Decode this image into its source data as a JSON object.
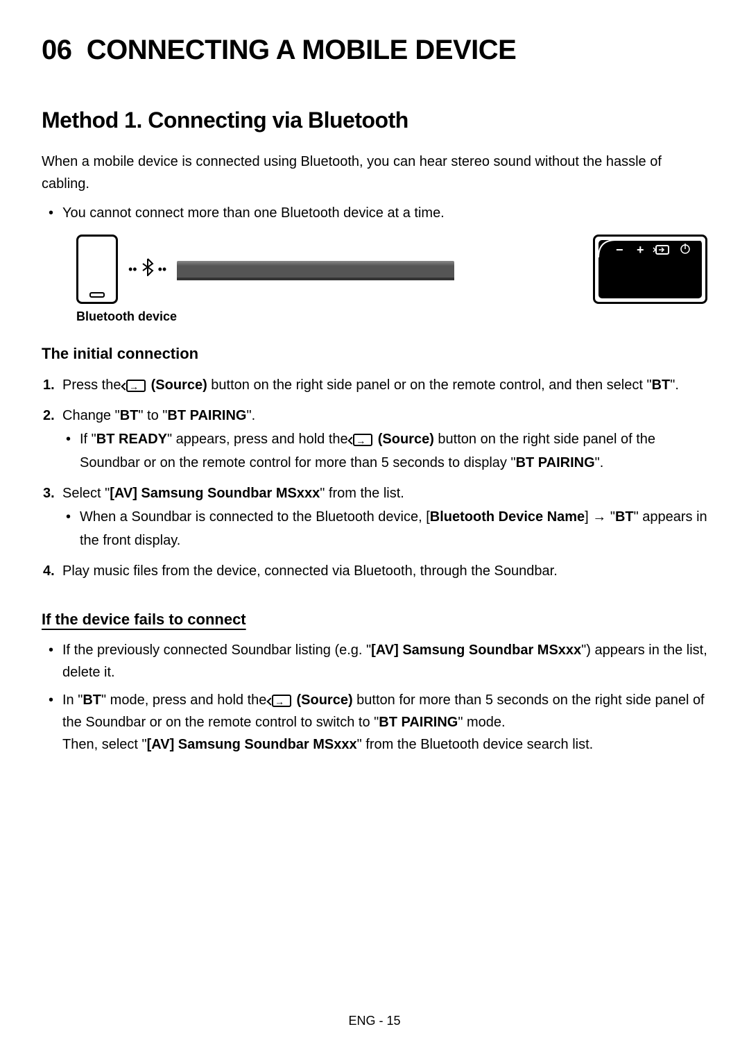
{
  "chapter": {
    "number": "06",
    "title": "CONNECTING A MOBILE DEVICE"
  },
  "method": {
    "title": "Method 1. Connecting via Bluetooth",
    "intro": "When a mobile device is connected using Bluetooth, you can hear stereo sound without the hassle of cabling.",
    "note": "You cannot connect more than one Bluetooth device at a time."
  },
  "diagram": {
    "label": "Bluetooth device"
  },
  "initial_connection": {
    "heading": "The initial connection",
    "steps": [
      {
        "prefix": "Press the ",
        "source_label": "(Source)",
        "suffix": " button on the right side panel or on the remote control, and then select \"",
        "bold_end": "BT",
        "tail": "\"."
      },
      {
        "prefix": "Change \"",
        "bold1": "BT",
        "mid": "\" to \"",
        "bold2": "BT PAIRING",
        "suffix": "\".",
        "sub": {
          "prefix": "If \"",
          "bold1": "BT READY",
          "mid1": "\" appears, press and hold the ",
          "source_label": "(Source)",
          "mid2": " button on the right side panel of the Soundbar or on the remote control for more than 5 seconds to display \"",
          "bold2": "BT PAIRING",
          "suffix": "\"."
        }
      },
      {
        "prefix": "Select \"",
        "bold1": "[AV] Samsung Soundbar MSxxx",
        "suffix": "\" from the list.",
        "sub": {
          "prefix": "When a Soundbar is connected to the Bluetooth device, [",
          "bold1": "Bluetooth Device Name",
          "mid": "] → \"",
          "bold2": "BT",
          "suffix": "\" appears in the front display."
        }
      },
      {
        "text": "Play music files from the device, connected via Bluetooth, through the Soundbar."
      }
    ]
  },
  "fails_to_connect": {
    "heading": "If the device fails to connect",
    "items": [
      {
        "prefix": "If the previously connected Soundbar listing (e.g. \"",
        "bold1": "[AV] Samsung Soundbar MSxxx",
        "suffix": "\") appears in the list, delete it."
      },
      {
        "prefix": "In \"",
        "bold1": "BT",
        "mid1": "\" mode, press and hold the ",
        "source_label": "(Source)",
        "mid2": " button for more than 5 seconds on the right side panel of the Soundbar or on the remote control to switch to \"",
        "bold2": "BT PAIRING",
        "mid3": "\" mode.",
        "line2_prefix": "Then, select \"",
        "line2_bold": "[AV] Samsung Soundbar MSxxx",
        "line2_suffix": "\" from the Bluetooth device search list."
      }
    ]
  },
  "footer": "ENG - 15"
}
